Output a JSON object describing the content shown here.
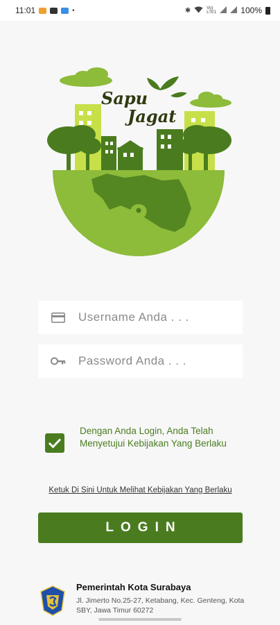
{
  "status_bar": {
    "time": "11:01",
    "battery": "100%",
    "network_labels": "Vo) LTE1"
  },
  "logo": {
    "title_line1": "Sapu",
    "title_line2": "Jagat"
  },
  "form": {
    "username_placeholder": "Username Anda . . .",
    "password_placeholder": "Password Anda . . .",
    "agree_checked": true,
    "agree_text": "Dengan Anda Login, Anda Telah Menyetujui Kebijakan Yang Berlaku",
    "policy_link": "Ketuk Di Sini Untuk Melihat Kebijakan Yang Berlaku",
    "login_label": "LOGIN"
  },
  "footer": {
    "title": "Pemerintah Kota Surabaya",
    "address": "Jl. Jimerto No.25-27, Ketabang, Kec. Genteng, Kota SBY, Jawa Timur 60272"
  },
  "colors": {
    "primary_green": "#4a7c1f",
    "light_green": "#8dbb3a",
    "lime": "#c7e04a",
    "background": "#f7f7f7"
  }
}
